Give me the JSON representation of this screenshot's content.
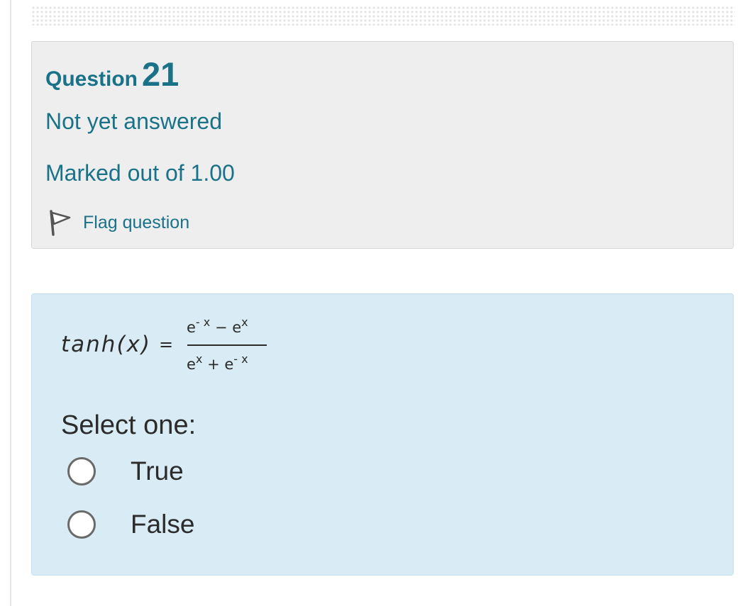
{
  "question": {
    "word": "Question",
    "number": "21",
    "state": "Not yet answered",
    "marks": "Marked out of 1.00",
    "flag_label": "Flag question"
  },
  "formula": {
    "lhs": "tanh(x)",
    "equals": "=",
    "numerator": {
      "a_base": "e",
      "a_exp": "- x",
      "op": "−",
      "b_base": "e",
      "b_exp": "x"
    },
    "denominator": {
      "a_base": "e",
      "a_exp": "x",
      "op": "+",
      "b_base": "e",
      "b_exp": "- x"
    }
  },
  "prompt": "Select one:",
  "options": [
    {
      "label": "True",
      "selected": false
    },
    {
      "label": "False",
      "selected": false
    }
  ],
  "colors": {
    "accent": "#1a7289",
    "info_bg": "#eeeeee",
    "formulation_bg": "#d9ecf5",
    "text": "#2b2b2b"
  },
  "icons": {
    "flag": "flag-icon",
    "radio": "radio-unchecked-icon"
  }
}
